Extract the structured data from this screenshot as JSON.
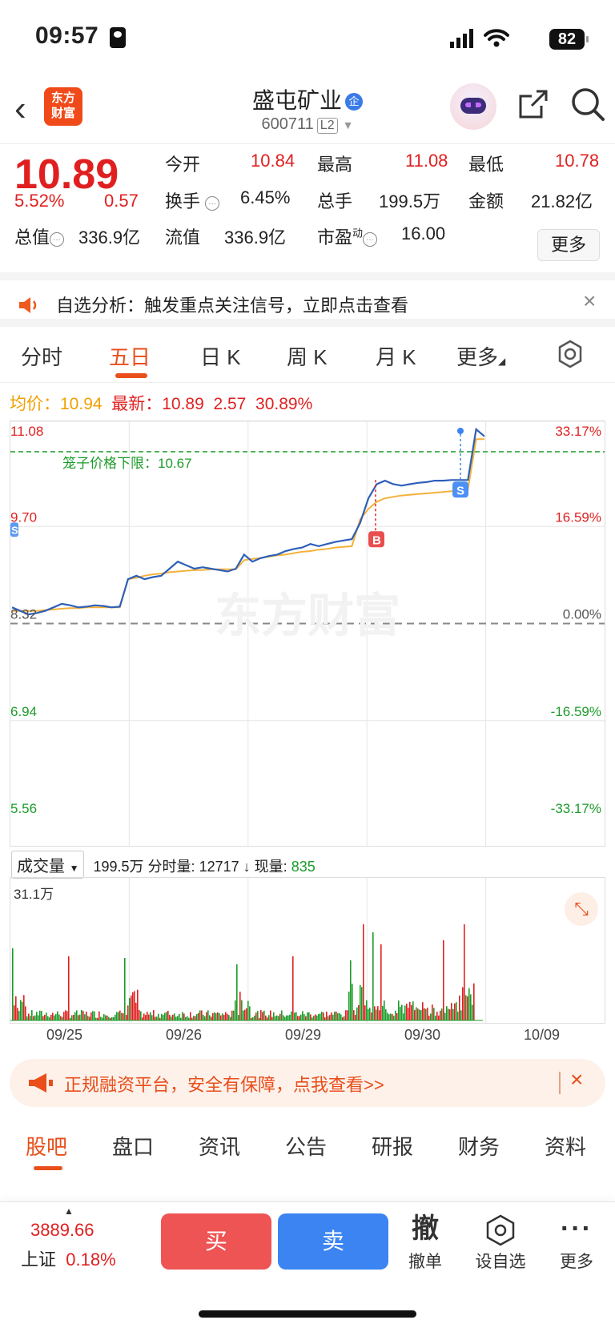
{
  "status": {
    "time": "09:57",
    "battery": "82"
  },
  "header": {
    "back": "‹",
    "logo_line1": "东方",
    "logo_line2": "财富",
    "stock_name": "盛屯矿业",
    "badge": "企",
    "stock_code": "600711",
    "level": "L2"
  },
  "quote": {
    "price": "10.89",
    "pct": "5.52%",
    "change": "0.57",
    "open_label": "今开",
    "open": "10.84",
    "high_label": "最高",
    "high": "11.08",
    "low_label": "最低",
    "low": "10.78",
    "turnover_label": "换手",
    "turnover": "6.45%",
    "volume_label": "总手",
    "volume": "199.5万",
    "amount_label": "金额",
    "amount": "21.82亿",
    "mcap_label": "总值",
    "mcap": "336.9亿",
    "float_label": "流值",
    "float": "336.9亿",
    "pe_label": "市盈",
    "pe_sup": "动",
    "pe": "16.00",
    "more": "更多"
  },
  "notice": {
    "text": "自选分析：触发重点关注信号，立即点击查看",
    "close": "×"
  },
  "tabs": [
    "分时",
    "五日",
    "日 K",
    "周 K",
    "月 K",
    "更多"
  ],
  "avg_line": {
    "avg_label": "均价：",
    "avg": "10.94",
    "latest_label": "最新：",
    "latest": "10.89",
    "chg": "2.57",
    "pct": "30.89%"
  },
  "chart_data": {
    "type": "line",
    "title": "",
    "y_left_ticks": [
      "11.08",
      "9.70",
      "8.32",
      "6.94",
      "5.56"
    ],
    "y_right_ticks": [
      "33.17%",
      "16.59%",
      "0.00%",
      "-16.59%",
      "-33.17%"
    ],
    "ylim": [
      5.56,
      11.08
    ],
    "base": 8.32,
    "limit_label": "笼子价格下限：10.67",
    "limit_value": 10.67,
    "x_dates": [
      "09/25",
      "09/26",
      "09/29",
      "09/30",
      "10/09"
    ],
    "marks": [
      "S",
      "B",
      "S"
    ],
    "series": [
      {
        "name": "",
        "color": "#2e5fb8",
        "values": [
          8.55,
          8.5,
          8.45,
          8.47,
          8.5,
          8.55,
          8.6,
          8.58,
          8.55,
          8.56,
          8.58,
          8.57,
          8.55,
          8.56,
          8.95,
          9.0,
          8.95,
          8.98,
          9.0,
          9.1,
          9.2,
          9.15,
          9.1,
          9.12,
          9.1,
          9.08,
          9.06,
          9.1,
          9.3,
          9.2,
          9.25,
          9.28,
          9.3,
          9.35,
          9.38,
          9.4,
          9.45,
          9.42,
          9.45,
          9.48,
          9.5,
          9.52,
          9.75,
          10.1,
          10.3,
          10.35,
          10.3,
          10.28,
          10.3,
          10.32,
          10.33,
          10.35,
          10.35,
          10.36,
          10.36,
          10.36,
          11.08,
          10.98
        ]
      },
      {
        "name": "",
        "color": "#f3b23a",
        "values": [
          8.5,
          8.5,
          8.5,
          8.5,
          8.51,
          8.52,
          8.53,
          8.54,
          8.54,
          8.55,
          8.55,
          8.55,
          8.55,
          8.55,
          8.95,
          8.97,
          9.0,
          9.02,
          9.03,
          9.05,
          9.06,
          9.07,
          9.08,
          9.08,
          9.09,
          9.09,
          9.09,
          9.09,
          9.22,
          9.24,
          9.25,
          9.27,
          9.29,
          9.3,
          9.32,
          9.34,
          9.35,
          9.37,
          9.38,
          9.4,
          9.41,
          9.42,
          9.8,
          9.95,
          10.05,
          10.1,
          10.12,
          10.14,
          10.15,
          10.16,
          10.17,
          10.18,
          10.19,
          10.2,
          10.21,
          10.22,
          10.94,
          10.94
        ]
      }
    ]
  },
  "volume": {
    "select": "成交量",
    "total": "199.5万",
    "interval_label": "分时量:",
    "interval": "12717",
    "now_label": "现量:",
    "now": "835",
    "max_label": "31.1万"
  },
  "promo": {
    "text": "正规融资平台，安全有保障，点我查看>>",
    "close": "×"
  },
  "bottom_tabs": [
    "股吧",
    "盘口",
    "资讯",
    "公告",
    "研报",
    "财务",
    "资料"
  ],
  "footer": {
    "index_value": "3889.66",
    "index_name": "上证",
    "index_pct": "0.18%",
    "buy": "买",
    "sell": "卖",
    "cancel_icon": "撤",
    "cancel": "撤单",
    "watch": "设自选",
    "more": "更多"
  },
  "colors": {
    "accent": "#e94e1b",
    "up": "#e02020",
    "down": "#1c9c2a",
    "avg": "#f0a000",
    "buy": "#ef5455",
    "sell": "#3b84f2"
  }
}
